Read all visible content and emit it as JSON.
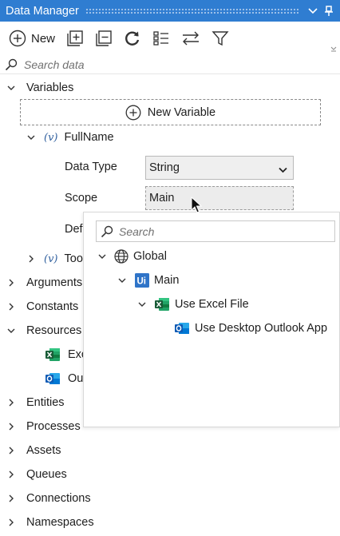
{
  "window": {
    "title": "Data Manager"
  },
  "toolbar": {
    "new_label": "New"
  },
  "search": {
    "placeholder": "Search data"
  },
  "tree": {
    "variables_label": "Variables",
    "new_variable_label": "New Variable",
    "variable_name": "FullName",
    "data_type_label": "Data Type",
    "data_type_value": "String",
    "scope_label": "Scope",
    "scope_value": "Main",
    "default_label_partial": "Def",
    "next_variable_partial": "Too",
    "arguments_label": "Arguments",
    "constants_label": "Constants",
    "resources_label": "Resources",
    "resource_excel_partial": "Exc",
    "resource_outlook_partial": "Ou",
    "entities_label": "Entities",
    "processes_label": "Processes",
    "assets_label": "Assets",
    "queues_label": "Queues",
    "connections_label": "Connections",
    "namespaces_label": "Namespaces"
  },
  "scope_popup": {
    "search_placeholder": "Search",
    "items": [
      {
        "label": "Global",
        "icon": "globe-icon"
      },
      {
        "label": "Main",
        "icon": "uipath-icon"
      },
      {
        "label": "Use Excel File",
        "icon": "excel-icon"
      },
      {
        "label": "Use Desktop Outlook App",
        "icon": "outlook-icon"
      }
    ]
  },
  "colors": {
    "titlebar": "#2f7dd1",
    "excel": "#1d6f42",
    "outlook": "#0f6cbd",
    "uipath": "#2f74c8"
  }
}
